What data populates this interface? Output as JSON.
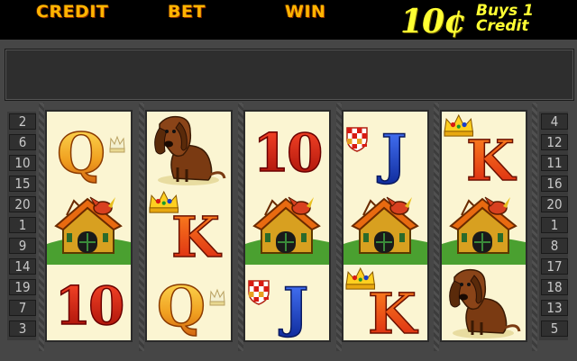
{
  "header": {
    "credit_label": "CREDIT",
    "bet_label": "BET",
    "win_label": "WIN",
    "denomination_amount": "10¢",
    "denomination_text_line1": "Buys 1",
    "denomination_text_line2": "Credit"
  },
  "message_bar": {
    "text": ""
  },
  "lines_left": [
    "2",
    "6",
    "10",
    "15",
    "20",
    "1",
    "9",
    "14",
    "19",
    "7",
    "3"
  ],
  "lines_right": [
    "4",
    "12",
    "11",
    "16",
    "20",
    "1",
    "8",
    "17",
    "18",
    "13",
    "5"
  ],
  "reels": [
    [
      "Q",
      "house",
      "10"
    ],
    [
      "dog",
      "K",
      "Q"
    ],
    [
      "10",
      "house",
      "J"
    ],
    [
      "J",
      "house",
      "K"
    ],
    [
      "K",
      "house",
      "dog"
    ]
  ],
  "symbols": {
    "Q": "Q",
    "K": "K",
    "J": "J",
    "10": "10"
  },
  "colors": {
    "label_orange": "#ffb400",
    "denom_yellow": "#ffff33",
    "reel_bg": "#fbf5d2",
    "frame_gray": "#464646",
    "red_symbol": "#d81a12",
    "blue_symbol": "#1a3ec8"
  },
  "icons": {
    "dog": "bloodhound-dog-icon",
    "house": "doghouse-icon",
    "crown": "crown-icon"
  }
}
